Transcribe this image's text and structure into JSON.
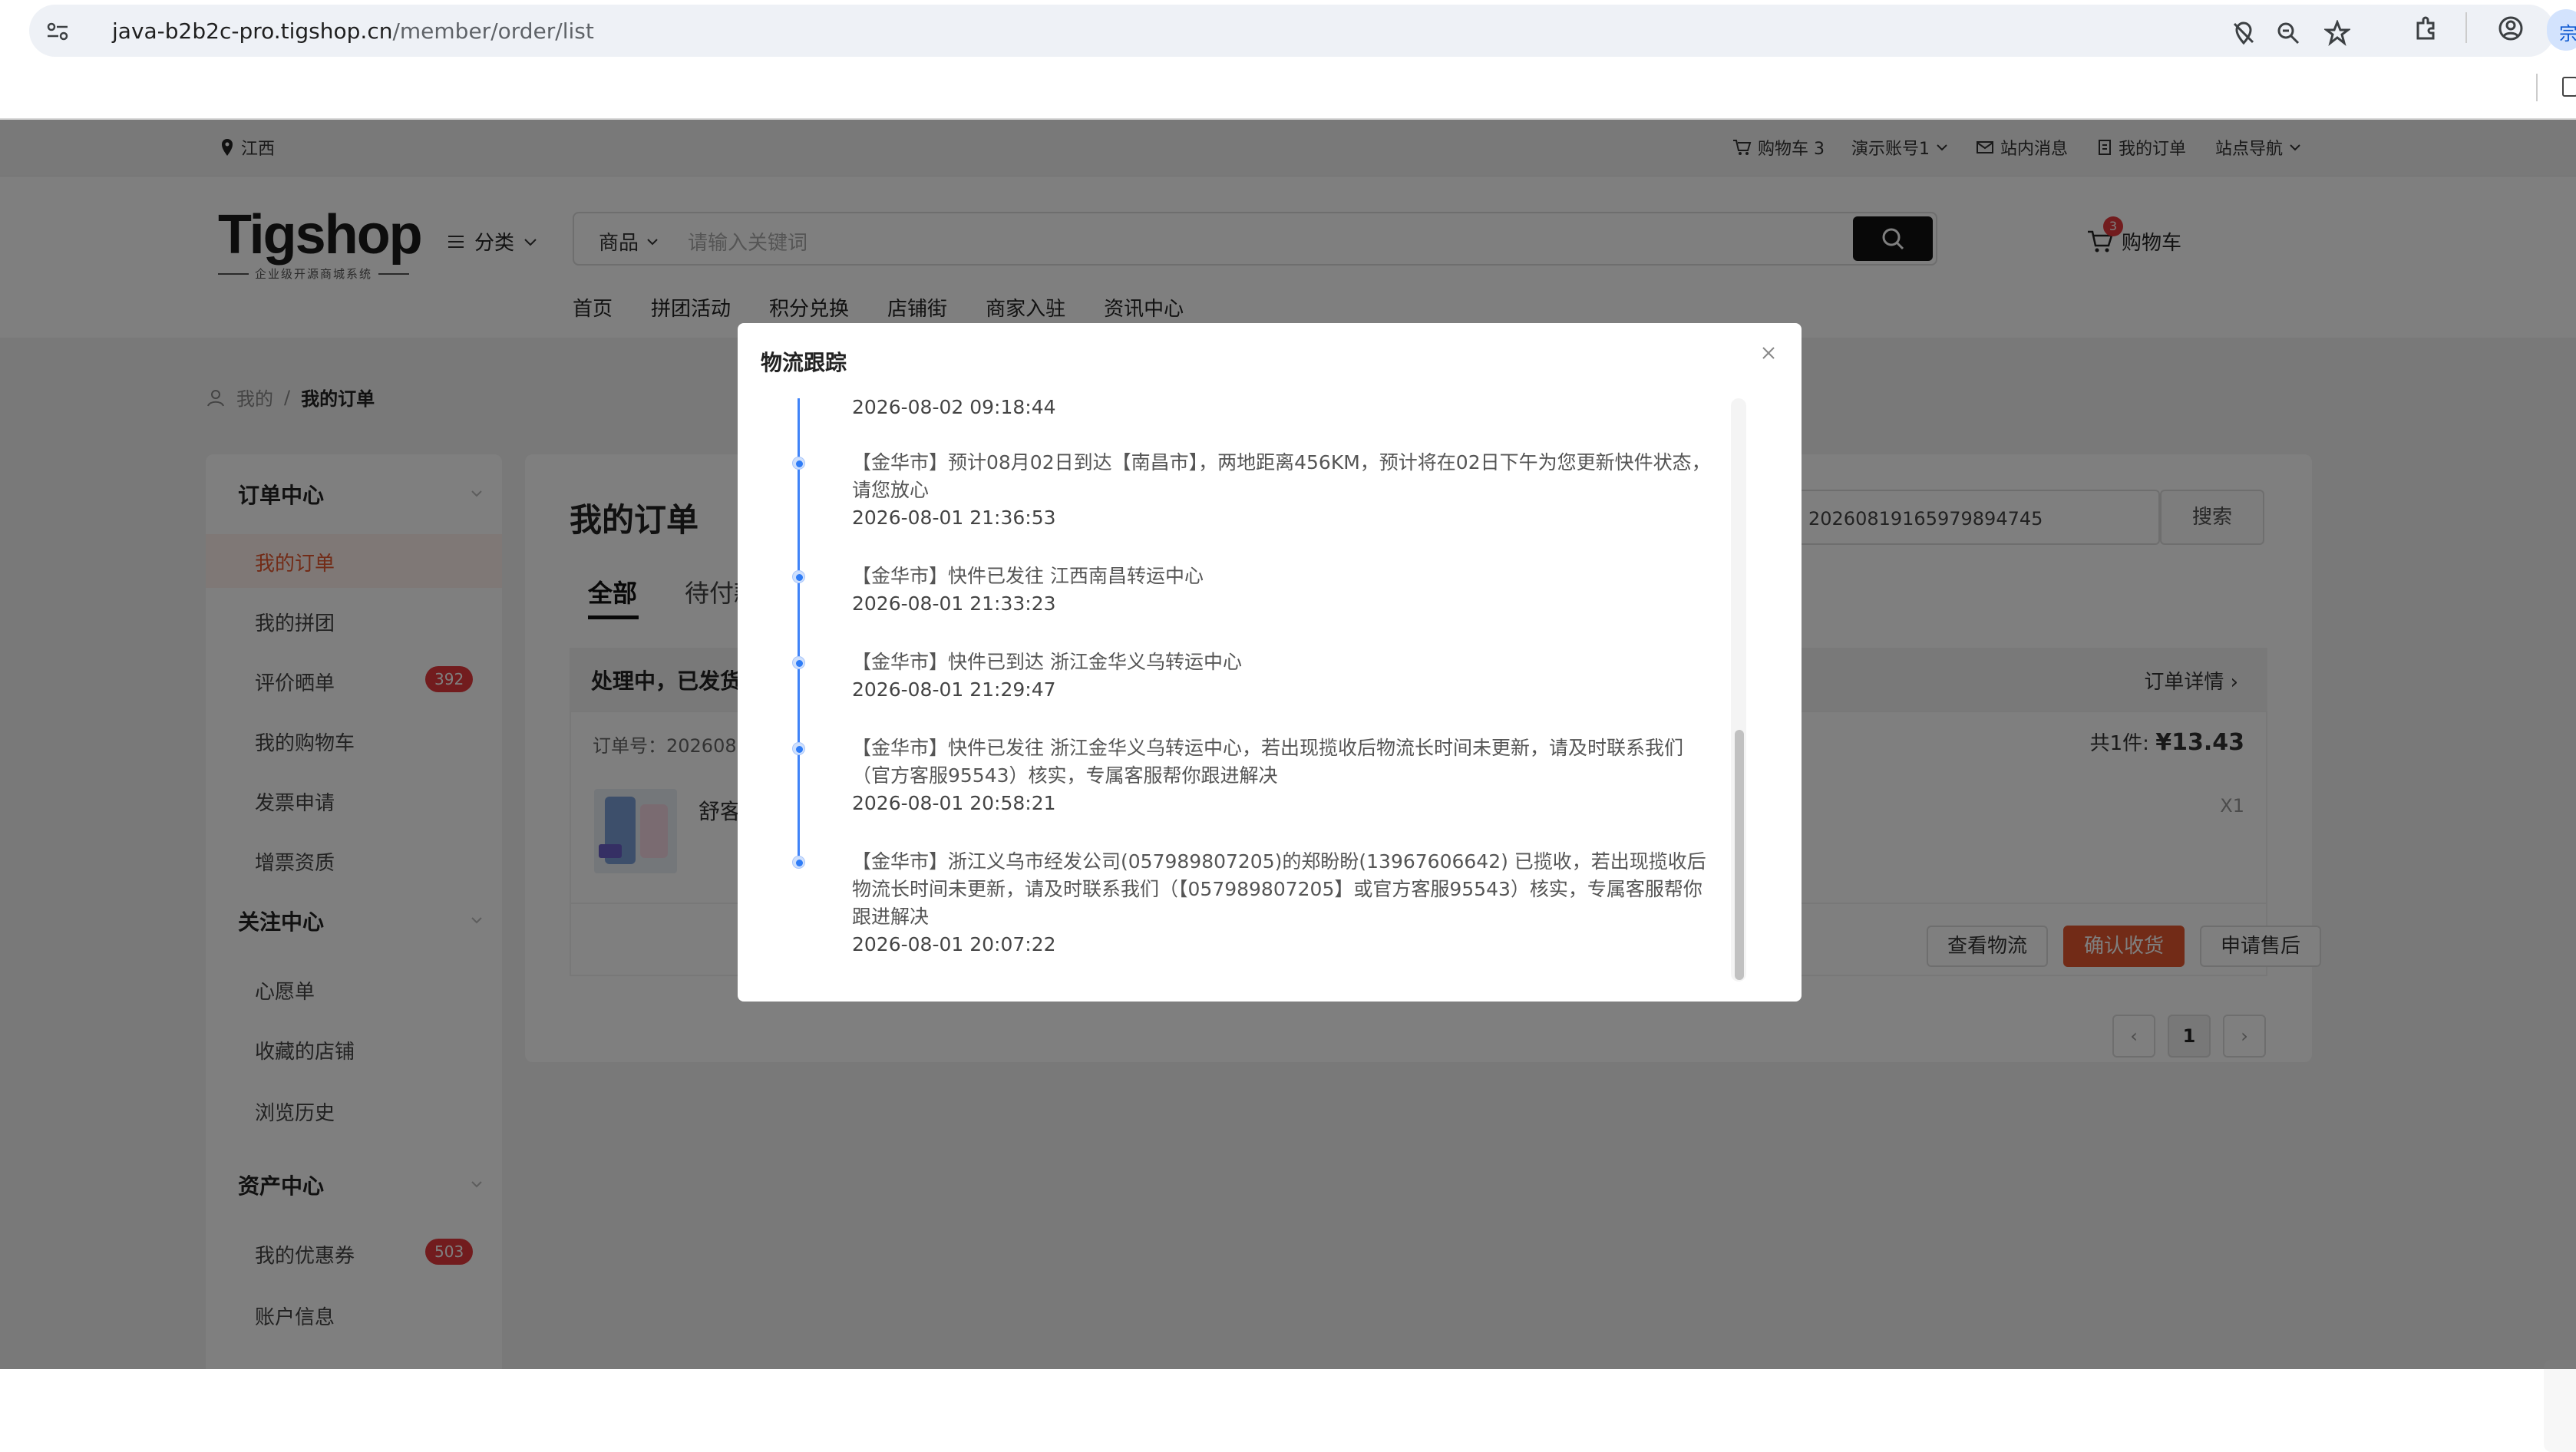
{
  "browser": {
    "url_host": "java-b2b2c-pro.tigshop.cn",
    "url_path": "/member/order/list",
    "profile_char": "宗"
  },
  "topbar": {
    "location": "江西",
    "cart": "购物车 3",
    "account": "演示账号1",
    "messages": "站内消息",
    "orders": "我的订单",
    "site_nav": "站点导航"
  },
  "header": {
    "logo": "Tigshop",
    "logo_sub": "企业级开源商城系统",
    "category": "分类",
    "search_type": "商品",
    "search_placeholder": "请输入关键词",
    "cart_label": "购物车",
    "cart_count": "3",
    "nav": [
      "首页",
      "拼团活动",
      "积分兑换",
      "店铺街",
      "商家入驻",
      "资讯中心"
    ]
  },
  "breadcrumb": {
    "home": "我的",
    "sep": "/",
    "current": "我的订单"
  },
  "sidebar": {
    "groups": [
      {
        "title": "订单中心",
        "items": [
          "我的订单",
          "我的拼团",
          "评价晒单",
          "我的购物车",
          "发票申请",
          "增票资质"
        ]
      },
      {
        "title": "关注中心",
        "items": [
          "心愿单",
          "收藏的店铺",
          "浏览历史"
        ]
      },
      {
        "title": "资产中心",
        "items": [
          "我的优惠券",
          "账户信息"
        ]
      }
    ],
    "badges": {
      "review": "392",
      "coupon": "503"
    }
  },
  "main": {
    "title": "我的订单",
    "tabs": [
      "全部",
      "待付款"
    ],
    "search_value": "20260819165979894745",
    "search_button": "搜索",
    "order": {
      "status": "处理中，已发货",
      "detail_link": "订单详情",
      "order_no": "订单号：202608191",
      "total_label": "共1件: ",
      "total_value": "¥13.43",
      "product": "舒客",
      "qty": "X1",
      "buttons": [
        "查看物流",
        "确认收货",
        "申请售后"
      ]
    },
    "page": "1"
  },
  "modal": {
    "title": "物流跟踪",
    "events": [
      {
        "text": "",
        "time": "2026-08-02 09:18:44"
      },
      {
        "text": "【金华市】预计08月02日到达【南昌市】，两地距离456KM，预计将在02日下午为您更新快件状态，请您放心",
        "time": "2026-08-01 21:36:53"
      },
      {
        "text": "【金华市】快件已发往 江西南昌转运中心",
        "time": "2026-08-01 21:33:23"
      },
      {
        "text": "【金华市】快件已到达 浙江金华义乌转运中心",
        "time": "2026-08-01 21:29:47"
      },
      {
        "text": "【金华市】快件已发往 浙江金华义乌转运中心，若出现揽收后物流长时间未更新，请及时联系我们（官方客服95543）核实，专属客服帮你跟进解决",
        "time": "2026-08-01 20:58:21"
      },
      {
        "text": "【金华市】浙江义乌市经发公司(057989807205)的郑盼盼(13967606642) 已揽收，若出现揽收后物流长时间未更新，请及时联系我们（【057989807205】或官方客服95543）核实，专属客服帮你跟进解决",
        "time": "2026-08-01 20:07:22"
      }
    ]
  }
}
